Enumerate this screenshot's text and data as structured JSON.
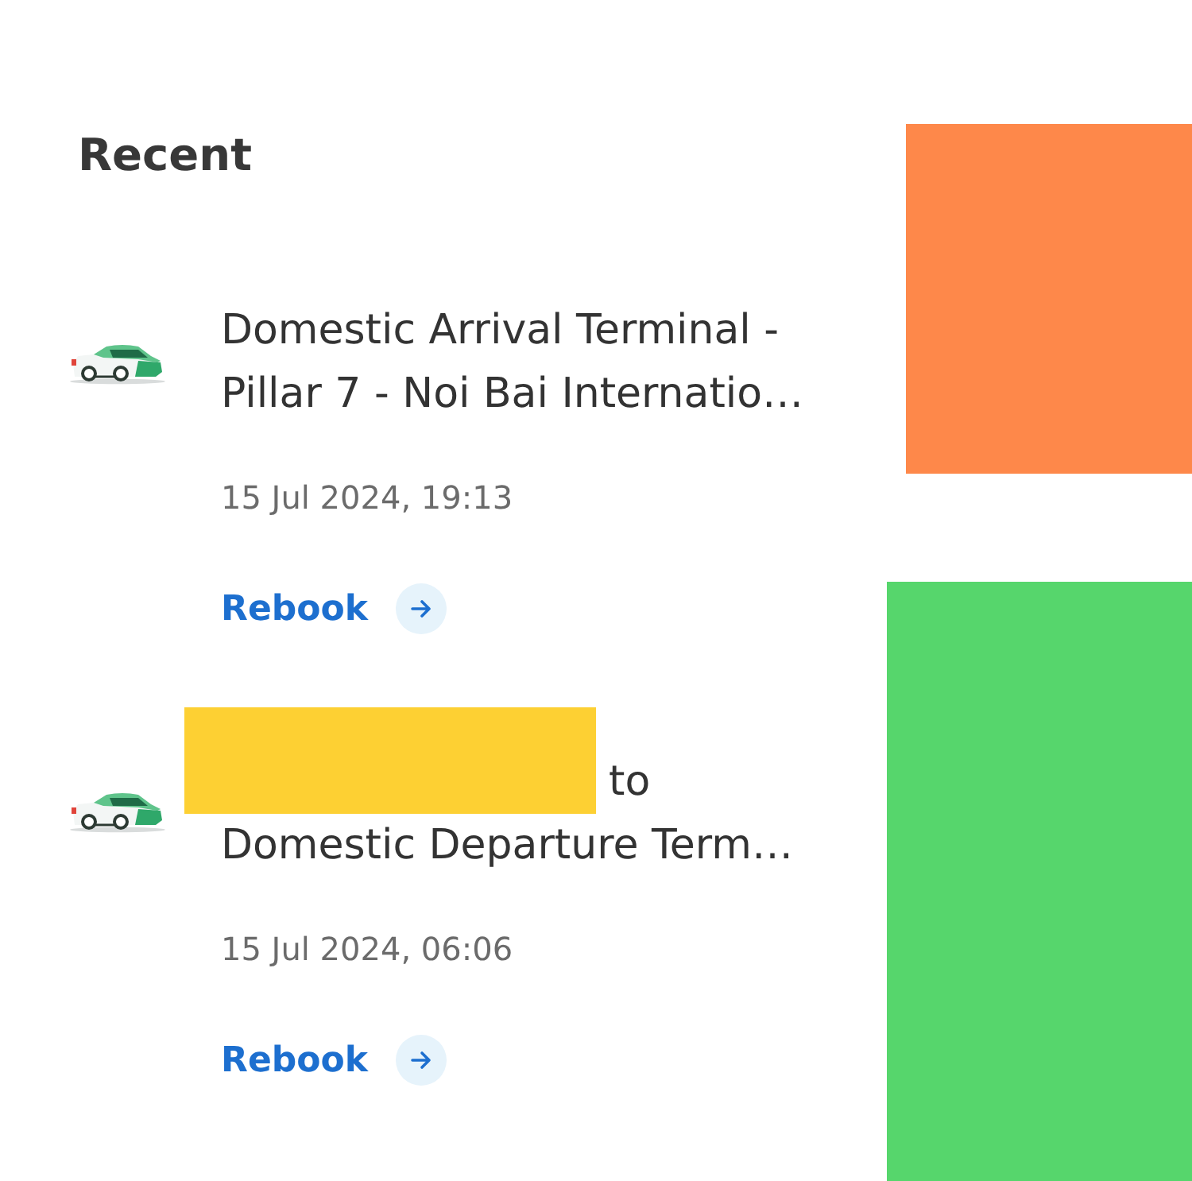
{
  "section_title": "Recent",
  "trips": [
    {
      "lines": [
        "Domestic Arrival Terminal -",
        "Pillar 7 - Noi Bai Internatio…"
      ],
      "redacted_start": false,
      "date": "15 Jul 2024, 19:13",
      "action": "Rebook"
    },
    {
      "lines": [
        "to",
        "Domestic Departure Term…"
      ],
      "redacted_start": true,
      "date": "15 Jul 2024, 06:06",
      "action": "Rebook"
    }
  ],
  "side_panels": [
    {
      "color": "#fe884a"
    },
    {
      "color": "#56d66c"
    }
  ]
}
